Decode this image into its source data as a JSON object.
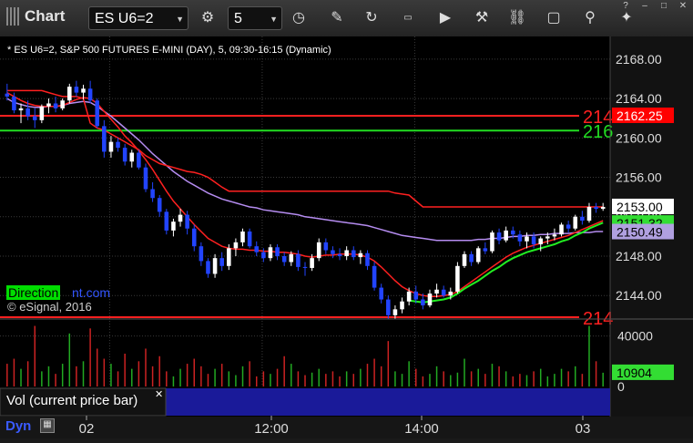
{
  "window": {
    "title": "Chart",
    "symbol": "ES U6=2",
    "interval": "5"
  },
  "toolbar": [
    "pencil-icon",
    "refresh-icon",
    "get-icon",
    "play-icon",
    "tools-icon",
    "message-icon",
    "tweet-icon"
  ],
  "chart_data": {
    "type": "candlestick",
    "title": "* ES U6=2, S&P 500 FUTURES E-MINI (DAY), 5, 09:30-16:15 (Dynamic)",
    "price_ticks": [
      "2168.00",
      "2164.00",
      "2160.00",
      "2156.00",
      "2152.00",
      "2148.00",
      "2144.00"
    ],
    "price_tick_values": [
      2168,
      2164,
      2160,
      2156,
      2152,
      2148,
      2144
    ],
    "ylim": [
      2141.8,
      2170.3
    ],
    "time_ticks": [
      "02",
      "12:00",
      "14:00",
      "03"
    ],
    "price_tags": [
      {
        "text": "2162.25",
        "value": 2162.25,
        "color": "#ff0000",
        "fg": "#ffffff"
      },
      {
        "text": "2153.00",
        "value": 2153.0,
        "color": "#ffffff",
        "fg": "#000000"
      },
      {
        "text": "2151.32",
        "value": 2151.32,
        "color": "#33dd33",
        "fg": "#000000"
      },
      {
        "text": "2150.49",
        "value": 2150.45,
        "color": "#b0a0e0",
        "fg": "#000000"
      }
    ],
    "hlines": [
      {
        "value": 2162.25,
        "color": "#ff2020",
        "label": "214"
      },
      {
        "value": 2160.75,
        "color": "#22dd22",
        "label": "216"
      },
      {
        "value": 2141.8,
        "color": "#ff2020",
        "label": "214"
      }
    ],
    "candles": [
      [
        2164.5,
        2165.5,
        2163.8,
        2164.2
      ],
      [
        2164.2,
        2164.6,
        2162.5,
        2162.8
      ],
      [
        2162.8,
        2163.5,
        2161.5,
        2163.0
      ],
      [
        2163.0,
        2163.8,
        2161.8,
        2162.2
      ],
      [
        2162.2,
        2163.0,
        2161.0,
        2161.8
      ],
      [
        2161.8,
        2163.4,
        2161.5,
        2163.2
      ],
      [
        2163.2,
        2164.0,
        2162.5,
        2163.5
      ],
      [
        2163.5,
        2164.2,
        2162.6,
        2163.0
      ],
      [
        2163.0,
        2164.0,
        2162.8,
        2163.8
      ],
      [
        2163.8,
        2165.5,
        2163.5,
        2165.2
      ],
      [
        2165.2,
        2165.8,
        2164.2,
        2164.6
      ],
      [
        2164.6,
        2165.4,
        2163.9,
        2165.0
      ],
      [
        2165.0,
        2165.8,
        2163.5,
        2163.8
      ],
      [
        2163.8,
        2164.0,
        2161.0,
        2161.2
      ],
      [
        2161.2,
        2161.8,
        2158.0,
        2158.6
      ],
      [
        2158.6,
        2160.2,
        2158.0,
        2159.6
      ],
      [
        2159.6,
        2160.0,
        2158.6,
        2159.0
      ],
      [
        2159.0,
        2159.4,
        2157.2,
        2157.6
      ],
      [
        2157.6,
        2158.8,
        2157.0,
        2158.5
      ],
      [
        2158.5,
        2158.8,
        2156.8,
        2157.0
      ],
      [
        2157.0,
        2157.4,
        2154.5,
        2154.8
      ],
      [
        2154.8,
        2155.5,
        2153.5,
        2153.9
      ],
      [
        2153.9,
        2154.2,
        2152.0,
        2152.5
      ],
      [
        2152.5,
        2152.8,
        2150.2,
        2150.6
      ],
      [
        2150.6,
        2151.8,
        2150.0,
        2151.5
      ],
      [
        2151.5,
        2152.8,
        2151.0,
        2152.2
      ],
      [
        2152.2,
        2152.6,
        2150.2,
        2150.8
      ],
      [
        2150.8,
        2151.2,
        2148.5,
        2149.0
      ],
      [
        2149.0,
        2149.4,
        2147.0,
        2147.5
      ],
      [
        2147.5,
        2147.8,
        2145.8,
        2146.2
      ],
      [
        2146.2,
        2148.2,
        2145.8,
        2147.8
      ],
      [
        2147.8,
        2148.4,
        2146.5,
        2147.0
      ],
      [
        2147.0,
        2149.2,
        2146.6,
        2148.8
      ],
      [
        2148.8,
        2149.8,
        2148.0,
        2149.4
      ],
      [
        2149.4,
        2150.8,
        2149.0,
        2150.5
      ],
      [
        2150.5,
        2150.8,
        2148.8,
        2149.0
      ],
      [
        2149.0,
        2149.5,
        2148.0,
        2148.4
      ],
      [
        2148.4,
        2148.8,
        2147.4,
        2147.8
      ],
      [
        2147.8,
        2149.2,
        2147.5,
        2148.9
      ],
      [
        2148.9,
        2149.2,
        2147.6,
        2148.0
      ],
      [
        2148.0,
        2148.4,
        2147.0,
        2147.4
      ],
      [
        2147.4,
        2148.5,
        2147.0,
        2148.2
      ],
      [
        2148.2,
        2148.6,
        2146.5,
        2146.9
      ],
      [
        2146.9,
        2147.4,
        2146.0,
        2146.8
      ],
      [
        2146.8,
        2148.2,
        2146.5,
        2147.8
      ],
      [
        2147.8,
        2149.8,
        2147.5,
        2149.4
      ],
      [
        2149.4,
        2149.8,
        2148.2,
        2148.6
      ],
      [
        2148.6,
        2149.0,
        2147.8,
        2148.2
      ],
      [
        2148.2,
        2148.8,
        2147.6,
        2148.0
      ],
      [
        2148.0,
        2149.0,
        2147.6,
        2148.6
      ],
      [
        2148.6,
        2149.0,
        2147.6,
        2147.9
      ],
      [
        2147.9,
        2148.6,
        2147.2,
        2148.3
      ],
      [
        2148.3,
        2148.6,
        2146.6,
        2147.0
      ],
      [
        2147.0,
        2147.4,
        2144.5,
        2144.8
      ],
      [
        2144.8,
        2145.2,
        2143.2,
        2143.6
      ],
      [
        2143.6,
        2144.0,
        2141.6,
        2142.0
      ],
      [
        2142.0,
        2143.0,
        2141.6,
        2142.6
      ],
      [
        2142.6,
        2143.8,
        2142.2,
        2143.4
      ],
      [
        2143.4,
        2144.8,
        2143.0,
        2144.4
      ],
      [
        2144.4,
        2145.0,
        2143.2,
        2143.6
      ],
      [
        2143.6,
        2144.2,
        2142.6,
        2143.0
      ],
      [
        2143.0,
        2144.6,
        2142.8,
        2144.2
      ],
      [
        2144.2,
        2145.2,
        2143.8,
        2144.6
      ],
      [
        2144.6,
        2145.0,
        2143.8,
        2144.0
      ],
      [
        2144.0,
        2144.8,
        2143.6,
        2144.4
      ],
      [
        2144.4,
        2147.4,
        2144.2,
        2147.0
      ],
      [
        2147.0,
        2148.5,
        2146.8,
        2148.2
      ],
      [
        2148.2,
        2148.5,
        2147.0,
        2147.4
      ],
      [
        2147.4,
        2149.0,
        2147.2,
        2148.8
      ],
      [
        2148.8,
        2149.4,
        2148.2,
        2148.5
      ],
      [
        2148.5,
        2150.6,
        2148.3,
        2150.4
      ],
      [
        2150.4,
        2150.8,
        2149.2,
        2149.6
      ],
      [
        2149.6,
        2151.0,
        2149.4,
        2150.6
      ],
      [
        2150.6,
        2151.0,
        2149.8,
        2150.2
      ],
      [
        2150.2,
        2150.6,
        2149.0,
        2149.5
      ],
      [
        2149.5,
        2150.4,
        2148.8,
        2150.0
      ],
      [
        2150.0,
        2150.4,
        2148.8,
        2149.2
      ],
      [
        2149.2,
        2150.0,
        2148.5,
        2149.8
      ],
      [
        2149.8,
        2150.4,
        2149.2,
        2150.0
      ],
      [
        2150.0,
        2150.8,
        2149.6,
        2150.2
      ],
      [
        2150.2,
        2151.4,
        2150.0,
        2151.2
      ],
      [
        2151.2,
        2151.6,
        2150.4,
        2150.8
      ],
      [
        2150.8,
        2152.2,
        2150.6,
        2152.0
      ],
      [
        2152.0,
        2152.6,
        2151.2,
        2151.6
      ],
      [
        2151.6,
        2153.4,
        2151.4,
        2153.0
      ],
      [
        2153.0,
        2153.4,
        2152.4,
        2152.8
      ],
      [
        2152.8,
        2153.4,
        2152.6,
        2153.0
      ]
    ],
    "ma_red_fast": [
      2164.6,
      2164.2,
      2163.8,
      2163.5,
      2163.3,
      2163.2,
      2163.2,
      2163.2,
      2163.3,
      2163.6,
      2163.9,
      2164.1,
      2164.0,
      2163.5,
      2162.7,
      2161.9,
      2161.1,
      2160.2,
      2159.5,
      2158.7,
      2157.8,
      2156.8,
      2155.7,
      2154.6,
      2153.6,
      2152.8,
      2152.0,
      2151.2,
      2150.5,
      2149.8,
      2149.4,
      2149.0,
      2148.8,
      2148.7,
      2148.7,
      2148.6,
      2148.6,
      2148.5,
      2148.5,
      2148.4,
      2148.4,
      2148.3,
      2148.2,
      2148.0,
      2147.9,
      2148.0,
      2148.1,
      2148.1,
      2148.2,
      2148.2,
      2148.2,
      2148.1,
      2147.9,
      2147.5,
      2146.9,
      2146.2,
      2145.5,
      2144.9,
      2144.5,
      2144.2,
      2144.0,
      2143.9,
      2143.9,
      2144.0,
      2144.1,
      2144.4,
      2144.9,
      2145.4,
      2145.9,
      2146.4,
      2146.9,
      2147.4,
      2147.9,
      2148.3,
      2148.6,
      2148.9,
      2149.1,
      2149.3,
      2149.5,
      2149.7,
      2149.9,
      2150.1,
      2150.4,
      2150.7,
      2151.0,
      2151.3,
      2151.6
    ],
    "ma_red_slow_const": [
      2164.8,
      2164.8,
      2164.8,
      2164.8,
      2164.8,
      2164.8,
      2164.6,
      2164.4,
      2164.2,
      2164.2,
      2164.2,
      2164.0,
      2161.5,
      2161.0,
      2160.8,
      2160.4,
      2160.0,
      2159.6,
      2159.2,
      2158.8,
      2158.2,
      2157.8,
      2157.4,
      2157.2,
      2157.0,
      2156.8,
      2156.6,
      2156.5,
      2156.3,
      2156.0,
      2155.5,
      2155.0,
      2154.6,
      2154.6,
      2154.6,
      2154.6,
      2154.6,
      2154.6,
      2154.6,
      2154.6,
      2154.6,
      2154.6,
      2154.6,
      2154.6,
      2154.6,
      2154.6,
      2154.6,
      2154.6,
      2154.6,
      2154.6,
      2154.6,
      2154.6,
      2154.6,
      2154.6,
      2154.6,
      2154.6,
      2154.4,
      2154.3,
      2154.2,
      2153.6,
      2153.0,
      2153.0,
      2153.0,
      2153.0,
      2153.0,
      2153.0,
      2153.0,
      2153.0,
      2153.0,
      2153.0,
      2153.0,
      2153.0,
      2153.0,
      2153.0,
      2153.0,
      2153.0,
      2153.0,
      2153.0,
      2153.0,
      2153.0,
      2153.0,
      2153.0,
      2153.0,
      2153.0,
      2153.0,
      2153.0,
      2153.0
    ],
    "vwap": [
      2164.0,
      2163.6,
      2163.4,
      2163.2,
      2163.1,
      2163.1,
      2163.2,
      2163.2,
      2163.3,
      2163.5,
      2163.6,
      2163.7,
      2163.6,
      2163.2,
      2162.7,
      2162.2,
      2161.6,
      2161.0,
      2160.4,
      2159.8,
      2159.1,
      2158.4,
      2157.8,
      2157.2,
      2156.6,
      2156.1,
      2155.6,
      2155.2,
      2154.8,
      2154.4,
      2154.1,
      2153.8,
      2153.6,
      2153.4,
      2153.2,
      2153.0,
      2152.9,
      2152.7,
      2152.6,
      2152.5,
      2152.4,
      2152.3,
      2152.2,
      2152.0,
      2151.9,
      2151.8,
      2151.7,
      2151.6,
      2151.5,
      2151.4,
      2151.3,
      2151.2,
      2151.1,
      2150.9,
      2150.7,
      2150.5,
      2150.3,
      2150.1,
      2150.0,
      2149.9,
      2149.8,
      2149.7,
      2149.6,
      2149.6,
      2149.6,
      2149.6,
      2149.6,
      2149.6,
      2149.7,
      2149.7,
      2149.8,
      2149.8,
      2149.9,
      2150.0,
      2150.0,
      2150.1,
      2150.1,
      2150.2,
      2150.2,
      2150.3,
      2150.3,
      2150.3,
      2150.4,
      2150.4,
      2150.4,
      2150.5,
      2150.5
    ],
    "ma_green": [
      null,
      null,
      null,
      null,
      null,
      null,
      null,
      null,
      null,
      null,
      null,
      null,
      null,
      null,
      null,
      null,
      null,
      null,
      null,
      null,
      null,
      null,
      null,
      null,
      null,
      null,
      null,
      null,
      null,
      null,
      null,
      null,
      null,
      null,
      null,
      null,
      null,
      null,
      null,
      null,
      null,
      null,
      null,
      null,
      null,
      null,
      null,
      null,
      null,
      null,
      null,
      null,
      null,
      null,
      null,
      null,
      null,
      null,
      2143.5,
      2143.4,
      2143.3,
      2143.4,
      2143.5,
      2143.6,
      2143.8,
      2144.2,
      2144.7,
      2145.1,
      2145.5,
      2146.0,
      2146.5,
      2146.9,
      2147.4,
      2147.8,
      2148.1,
      2148.4,
      2148.6,
      2148.8,
      2149.0,
      2149.2,
      2149.5,
      2149.7,
      2150.1,
      2150.4,
      2150.8,
      2151.1,
      2151.4
    ],
    "volume_axis": {
      "ticks": [
        "40000",
        "0"
      ],
      "tick_values": [
        40000,
        0
      ],
      "max": 52000,
      "tag": "10904",
      "tag_value": 10904
    },
    "volume": [
      18000,
      22000,
      14000,
      20000,
      48000,
      12000,
      16000,
      10000,
      18000,
      42000,
      16000,
      20000,
      46000,
      30000,
      22000,
      18000,
      12000,
      26000,
      14000,
      20000,
      30000,
      16000,
      24000,
      12000,
      8000,
      14000,
      18000,
      22000,
      16000,
      10000,
      14000,
      18000,
      12000,
      9000,
      16000,
      20000,
      8000,
      12000,
      10000,
      14000,
      24000,
      18000,
      12000,
      9000,
      11000,
      14000,
      10000,
      12000,
      8000,
      12000,
      10000,
      14000,
      18000,
      22000,
      16000,
      36000,
      12000,
      10000,
      20000,
      14000,
      8000,
      10000,
      16000,
      12000,
      9000,
      11000,
      22000,
      12000,
      14000,
      10000,
      18000,
      16000,
      12000,
      8000,
      10000,
      9000,
      12000,
      14000,
      8000,
      10000,
      14000,
      12000,
      16000,
      10000,
      48000,
      20000,
      10904
    ],
    "watermark": "© eSignal, 2016",
    "direction_label": "Direction",
    "direction_suffix": "nt.com",
    "vol_panel_title": "Vol (current price bar)",
    "bottom_left": "Dyn"
  },
  "colors": {
    "bull": "#ffffff",
    "bear": "#2244ff",
    "grid": "#3a3a3a",
    "bg": "#000000",
    "vol_bar_bull": "#22aa22",
    "vol_bar_bear": "#cc2222"
  }
}
